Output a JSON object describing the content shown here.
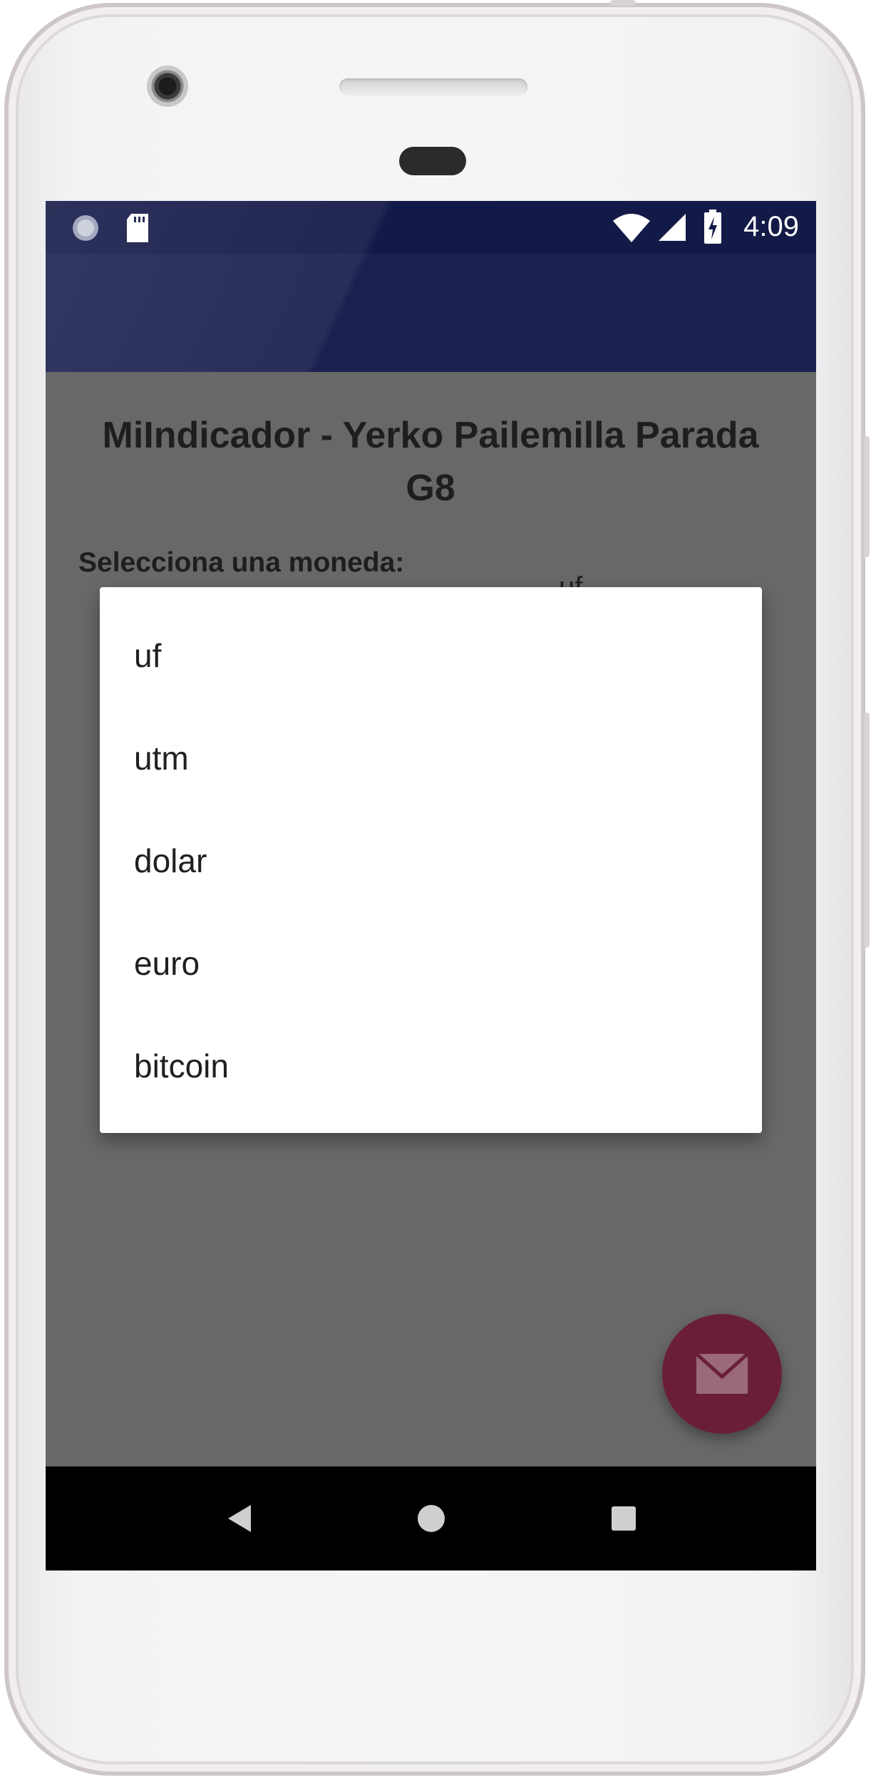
{
  "status_bar": {
    "time": "4:09",
    "icons": [
      "sync-icon",
      "sd-card-icon",
      "wifi-icon",
      "cellular-signal-icon",
      "battery-charging-icon"
    ]
  },
  "main": {
    "title": "MiIndicador - Yerko Pailemilla Parada G8",
    "prompt": "Selecciona una moneda:",
    "spinner_selected": "uf"
  },
  "dropdown": {
    "items": [
      "uf",
      "utm",
      "dolar",
      "euro",
      "bitcoin"
    ]
  },
  "fab": {
    "icon": "mail-icon"
  },
  "navigation": {
    "icons": [
      "back-icon",
      "home-icon",
      "recents-icon"
    ]
  },
  "colors": {
    "status_bar": "#141a48",
    "app_bar": "#1b214f",
    "scrim_background": "#686868",
    "fab": "#6b1f37",
    "dropdown_background": "#ffffff"
  }
}
